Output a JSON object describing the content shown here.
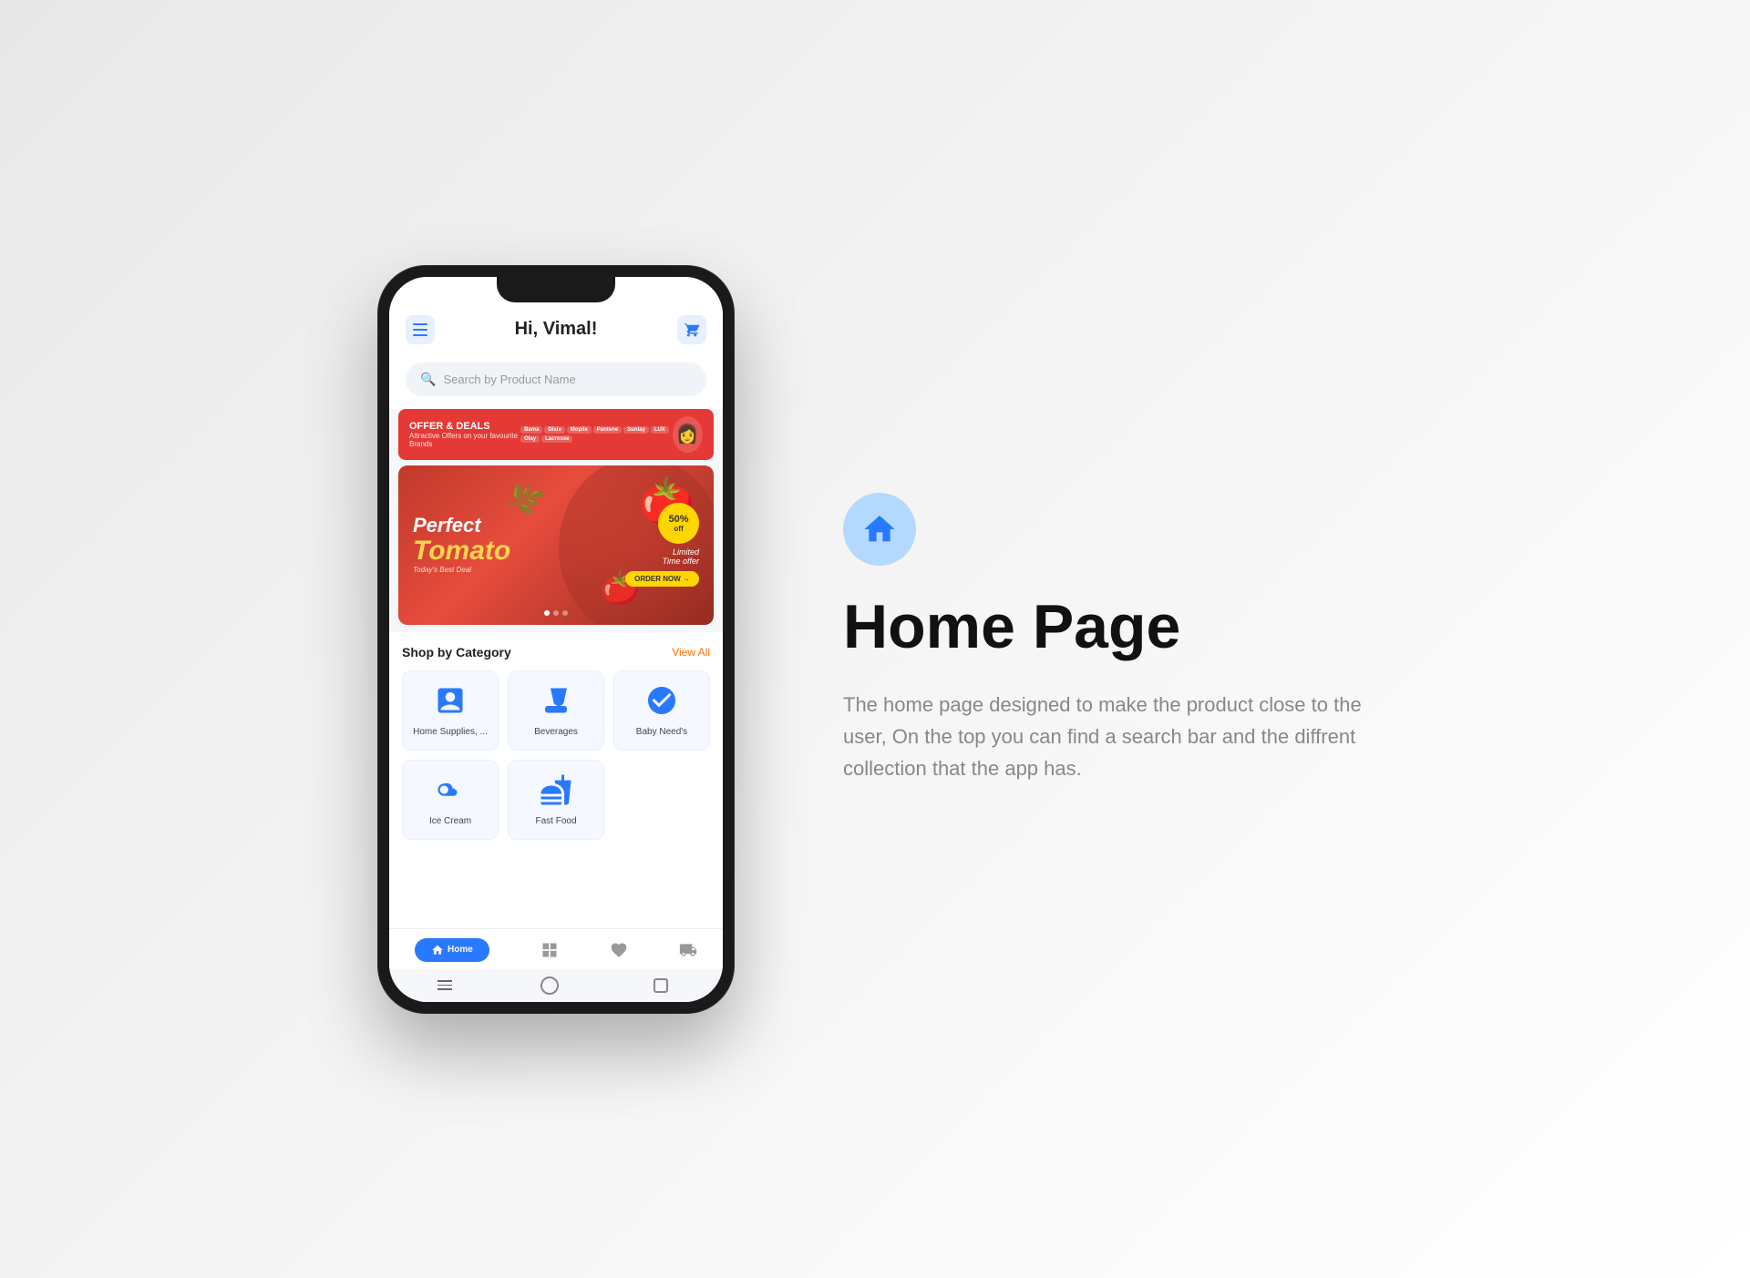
{
  "app": {
    "greeting": "Hi, Vimal!",
    "search_placeholder": "Search by Product Name",
    "offer": {
      "title": "OFFER & DEALS",
      "subtitle": "Attractive Offers on your favourite Brands",
      "brands": [
        "Bama",
        "Dixie",
        "Mopile",
        "Pantene",
        "Sunlay",
        "LUX",
        "Olay",
        "Lacrosse"
      ]
    },
    "hero": {
      "line1": "Perfect",
      "line2": "Tomato",
      "line3": "Today's Best Deal",
      "badge": "50% off",
      "label": "Limited Time offer",
      "cta": "ORDER NOW →"
    },
    "categories": {
      "title": "Shop by Category",
      "view_all": "View All",
      "items": [
        {
          "name": "Home Supplies, ..."
        },
        {
          "name": "Beverages"
        },
        {
          "name": "Baby Need's"
        },
        {
          "name": "Ice Cream"
        },
        {
          "name": "Fast Food"
        }
      ]
    },
    "nav": {
      "items": [
        {
          "label": "Home",
          "active": true
        },
        {
          "label": "Grid",
          "active": false
        },
        {
          "label": "Wishlist",
          "active": false
        },
        {
          "label": "Delivery",
          "active": false
        }
      ]
    }
  },
  "sidebar": {
    "icon_name": "home-icon-circle"
  },
  "right_panel": {
    "title": "Home Page",
    "description": "The home page designed to make the product close to the user, On the top you can find a search bar and the diffrent collection that the app has."
  }
}
